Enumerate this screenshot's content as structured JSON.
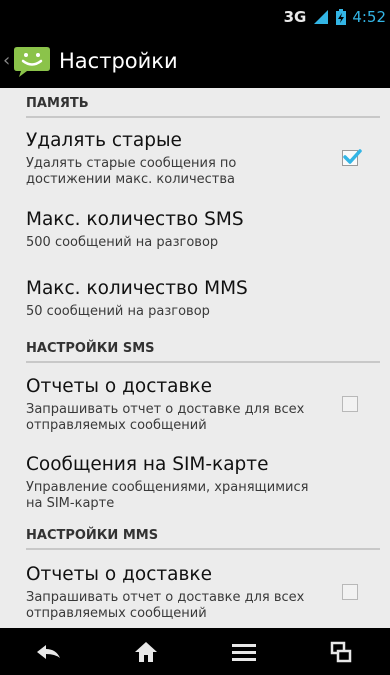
{
  "status_bar": {
    "network": "3G",
    "time": "4:52"
  },
  "action_bar": {
    "title": "Настройки"
  },
  "sections": [
    {
      "header": "ПАМЯТЬ"
    },
    {
      "header": "НАСТРОЙКИ SMS"
    },
    {
      "header": "НАСТРОЙКИ MMS"
    }
  ],
  "prefs": {
    "delete_old": {
      "title": "Удалять старые",
      "summary": "Удалять старые сообщения по достижении макс. количества",
      "checked": true
    },
    "max_sms": {
      "title": "Макс. количество SMS",
      "summary": "500 сообщений на разговор"
    },
    "max_mms": {
      "title": "Макс. количество MMS",
      "summary": "50 сообщений на разговор"
    },
    "sms_delivery": {
      "title": "Отчеты о доставке",
      "summary": "Запрашивать отчет о доставке для всех отправляемых сообщений",
      "checked": false
    },
    "sim_messages": {
      "title": "Сообщения на SIM-карте",
      "summary": "Управление сообщениями, хранящимися на SIM-карте"
    },
    "mms_delivery": {
      "title": "Отчеты о доставке",
      "summary": "Запрашивать отчет о доставке для всех отправляемых сообщений",
      "checked": false
    }
  },
  "colors": {
    "accent": "#33b5e5",
    "app_icon": "#8bc34a"
  }
}
